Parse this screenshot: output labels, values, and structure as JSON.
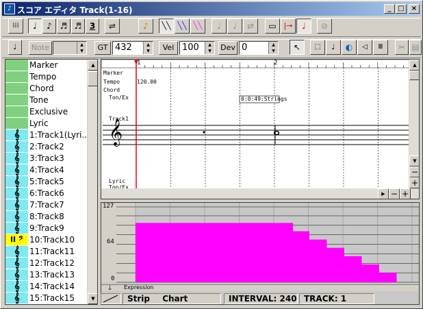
{
  "window": {
    "title": "スコア エディタ Track(1-16)",
    "app_icon": "app-icon",
    "minimize": "_",
    "maximize": "□",
    "close": "×"
  },
  "toolbar1": {
    "buttons": [
      {
        "name": "grid-button",
        "glyph": "⁞⁞⁞"
      },
      {
        "name": "quarter-note-button",
        "glyph": "♩"
      },
      {
        "name": "eighth-note-button",
        "glyph": "♪"
      },
      {
        "name": "sixteenth-note-button",
        "glyph": "♬"
      },
      {
        "name": "thirtysecond-note-button",
        "glyph": "♬"
      },
      {
        "name": "triplet-button",
        "glyph": "3"
      },
      {
        "name": "tie-button",
        "glyph": "⇌"
      },
      {
        "name": "auto-note-button",
        "glyph": "♪"
      },
      {
        "name": "black-pen-button",
        "glyph": "╲╲"
      },
      {
        "name": "blue-pen-button",
        "glyph": "╲╲"
      },
      {
        "name": "magenta-pen-button",
        "glyph": "╲╲"
      },
      {
        "name": "insert-note-button",
        "glyph": "♩"
      },
      {
        "name": "shift-note-button",
        "glyph": "♩"
      },
      {
        "name": "quantize-button",
        "glyph": "⇄"
      },
      {
        "name": "range-button",
        "glyph": "▭"
      },
      {
        "name": "marker-set-button",
        "glyph": "|→"
      },
      {
        "name": "play-from-button",
        "glyph": "♩"
      },
      {
        "name": "record-button",
        "glyph": "⊘"
      }
    ]
  },
  "toolbar2": {
    "note_toggle": "♩",
    "note_label": "Note",
    "note_value": "",
    "gt_label": "GT",
    "gt_value": "432",
    "vel_label": "Vel",
    "vel_value": "100",
    "dev_label": "Dev",
    "dev_value": "0",
    "tools": [
      "select-arrow",
      "select-range",
      "select-note",
      "select-eraser",
      "select-vel",
      "select-grid",
      "scissors",
      "paste"
    ]
  },
  "tracks": {
    "events": [
      {
        "label": "Marker",
        "color": "#7fd07f"
      },
      {
        "label": "Tempo",
        "color": "#7fd07f"
      },
      {
        "label": "Chord",
        "color": "#7fd07f"
      },
      {
        "label": "Tone",
        "color": "#7fd07f"
      },
      {
        "label": "Exclusive",
        "color": "#7fd07f"
      },
      {
        "label": "Lyric",
        "color": "#7fd07f"
      }
    ],
    "items": [
      {
        "label": "1:Track1(Lyri…",
        "clef": "𝄞",
        "color": "#80e8f0"
      },
      {
        "label": "2:Track2",
        "clef": "𝄞",
        "color": "#80e8f0"
      },
      {
        "label": "3:Track3",
        "clef": "𝄞",
        "color": "#80e8f0"
      },
      {
        "label": "4:Track4",
        "clef": "𝄞",
        "color": "#80e8f0"
      },
      {
        "label": "5:Track5",
        "clef": "𝄞",
        "color": "#80e8f0"
      },
      {
        "label": "6:Track6",
        "clef": "𝄞",
        "color": "#80e8f0"
      },
      {
        "label": "7:Track7",
        "clef": "𝄞",
        "color": "#80e8f0"
      },
      {
        "label": "8:Track8",
        "clef": "𝄞",
        "color": "#80e8f0"
      },
      {
        "label": "9:Track9",
        "clef": "𝄞",
        "color": "#80e8f0"
      },
      {
        "label": "10:Track10",
        "clef": "II 𝄢",
        "color": "#ffff00"
      },
      {
        "label": "11:Track11",
        "clef": "𝄞",
        "color": "#80e8f0"
      },
      {
        "label": "12:Track12",
        "clef": "𝄞",
        "color": "#80e8f0"
      },
      {
        "label": "13:Track13",
        "clef": "𝄞",
        "color": "#80e8f0"
      },
      {
        "label": "14:Track14",
        "clef": "𝄞",
        "color": "#80e8f0"
      },
      {
        "label": "15:Track15",
        "clef": "𝄞",
        "color": "#80e8f0"
      }
    ]
  },
  "score": {
    "measure_1": "1",
    "measure_2": "2",
    "marker_label": "Marker",
    "tempo_label": "Tempo",
    "tempo_value": "120.00",
    "chord_label": "Chord",
    "tonex_label": "Ton/Ex",
    "tonex_event": "0:0:49:Strings",
    "track_label": "Track1",
    "lyric_label": "Lyric",
    "tonex_label2": "Ton/Ex",
    "clef": "𝄞"
  },
  "strip": {
    "y_max": "127",
    "y_mid": "64",
    "y_min": "0",
    "controller": "Expression",
    "mode_strip": "Strip",
    "mode_chart": "Chart",
    "interval_text": "INTERVAL: 240",
    "track_text": "TRACK:    1",
    "values": [
      100,
      100,
      100,
      100,
      100,
      100,
      100,
      100,
      100,
      86,
      72,
      58,
      44,
      30,
      16
    ],
    "bar_color": "#ff00ff"
  },
  "zoom": {
    "minus": "−",
    "plus": "+"
  }
}
